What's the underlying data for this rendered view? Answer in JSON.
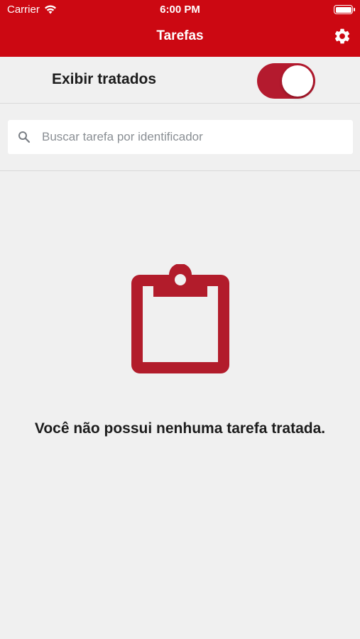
{
  "status_bar": {
    "carrier": "Carrier",
    "time": "6:00 PM"
  },
  "nav": {
    "title": "Tarefas",
    "settings_icon": "gear-icon"
  },
  "filter": {
    "label": "Exibir tratados",
    "toggle_on": true
  },
  "search": {
    "placeholder": "Buscar tarefa por identificador",
    "value": ""
  },
  "empty_state": {
    "icon": "clipboard-icon",
    "message": "Você não possui nenhuma tarefa tratada."
  },
  "colors": {
    "brand_red": "#cc0812",
    "toggle_red": "#b41a2e",
    "icon_red": "#b21c2b",
    "background": "#f0f0f0"
  }
}
